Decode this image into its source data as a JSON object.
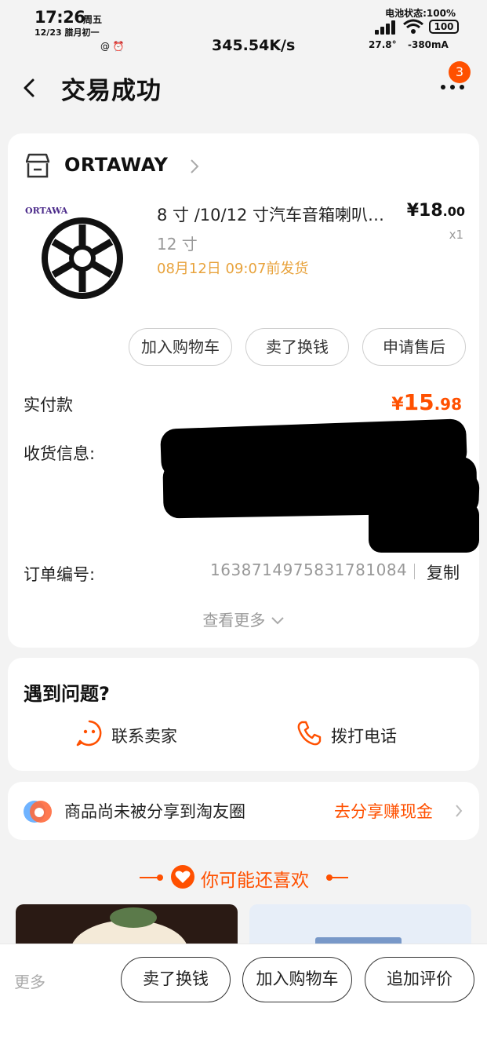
{
  "status_bar": {
    "time": "17:26",
    "weekday": "周五",
    "date": "12/23 腊月初一",
    "left_icons": "@ ⏰",
    "speed": "345.54K/s",
    "battery_status": "电池状态:100%",
    "battery_level": "100",
    "temperature": "27.8°",
    "current": "-380mA"
  },
  "nav": {
    "title": "交易成功",
    "badge_count": "3"
  },
  "order": {
    "shop_name": "ORTAWAY",
    "product_title": "8 寸 /10/12 寸汽车音箱喇叭…",
    "price_symbol": "¥",
    "price_int": "18",
    "price_dec": ".00",
    "quantity": "x1",
    "spec": "12 寸",
    "ship_note": "08月12日 09:07前发货",
    "brand_logo": "ORTAWA",
    "buttons": [
      "加入购物车",
      "卖了换钱",
      "申请售后"
    ],
    "paid_label": "实付款",
    "paid_symbol": "¥",
    "paid_int": "15",
    "paid_dec": ".98",
    "address_label": "收货信息:",
    "order_no_label": "订单编号:",
    "order_no": "1638714975831781084",
    "copy_label": "复制",
    "see_more": "查看更多"
  },
  "problem": {
    "title": "遇到问题?",
    "contact_seller": "联系卖家",
    "call_phone": "拨打电话"
  },
  "share": {
    "text": "商品尚未被分享到淘友圈",
    "cta": "去分享赚现金"
  },
  "recommend": {
    "title": "你可能还喜欢"
  },
  "bottom_bar": {
    "more": "更多",
    "buttons": [
      "卖了换钱",
      "加入购物车",
      "追加评价"
    ]
  },
  "colors": {
    "accent": "#ff5000",
    "ship_note": "#e8a33d",
    "muted": "#999999"
  }
}
